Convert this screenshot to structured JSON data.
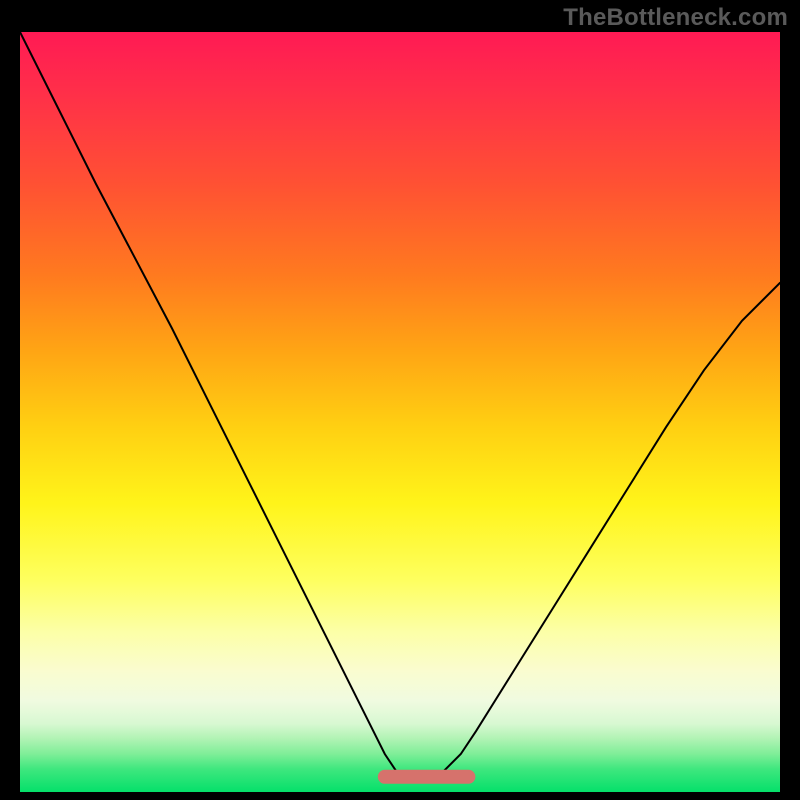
{
  "watermark": "TheBottleneck.com",
  "chart_data": {
    "type": "line",
    "title": "",
    "xlabel": "",
    "ylabel": "",
    "xlim": [
      0,
      100
    ],
    "ylim": [
      0,
      100
    ],
    "x": [
      0,
      5,
      10,
      15,
      20,
      25,
      30,
      35,
      40,
      45,
      48,
      50,
      52,
      55,
      58,
      60,
      65,
      70,
      75,
      80,
      85,
      90,
      95,
      100
    ],
    "series": [
      {
        "name": "bottleneck-curve",
        "values": [
          100,
          90,
          80,
          70.5,
          61,
          51,
          41,
          31,
          21,
          11,
          5,
          2,
          2,
          2,
          5,
          8,
          16,
          24,
          32,
          40,
          48,
          55.5,
          62,
          67
        ]
      }
    ],
    "highlight": {
      "name": "optimal-band",
      "color": "#d6726c",
      "x_range": [
        48,
        59
      ],
      "y": 2
    },
    "colors": {
      "curve": "#000000",
      "highlight": "#d6726c",
      "frame_bg_top": "#ff1a54",
      "frame_bg_bottom": "#05e06a",
      "page_bg": "#000000"
    }
  }
}
